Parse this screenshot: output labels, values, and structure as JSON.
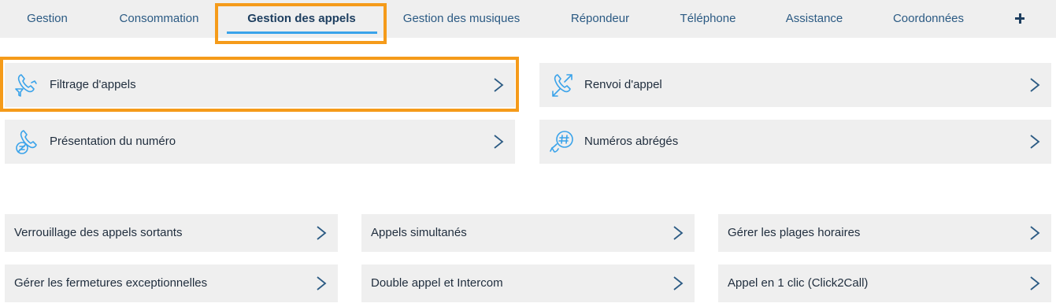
{
  "nav": {
    "items": [
      {
        "label": "Gestion"
      },
      {
        "label": "Consommation"
      },
      {
        "label": "Gestion des appels",
        "active": true
      },
      {
        "label": "Gestion des musiques"
      },
      {
        "label": "Répondeur"
      },
      {
        "label": "Téléphone"
      },
      {
        "label": "Assistance"
      },
      {
        "label": "Coordonnées"
      }
    ],
    "more_icon": "plus-icon"
  },
  "features": [
    {
      "label": "Filtrage d'appels",
      "icon": "call-filter-icon",
      "highlighted": true
    },
    {
      "label": "Renvoi d'appel",
      "icon": "call-forward-icon"
    },
    {
      "label": "Présentation du numéro",
      "icon": "number-presentation-icon"
    },
    {
      "label": "Numéros abrégés",
      "icon": "speed-dial-icon"
    }
  ],
  "options": [
    {
      "label": "Verrouillage des appels sortants"
    },
    {
      "label": "Appels simultanés"
    },
    {
      "label": "Gérer les plages horaires"
    },
    {
      "label": "Gérer les fermetures exceptionnelles"
    },
    {
      "label": "Double appel et Intercom"
    },
    {
      "label": "Appel en 1 clic (Click2Call)"
    }
  ],
  "colors": {
    "accent_blue": "#3aa3ea",
    "highlight_orange": "#f59b1a",
    "card_bg": "#efefef",
    "nav_text": "#2b5a83"
  }
}
